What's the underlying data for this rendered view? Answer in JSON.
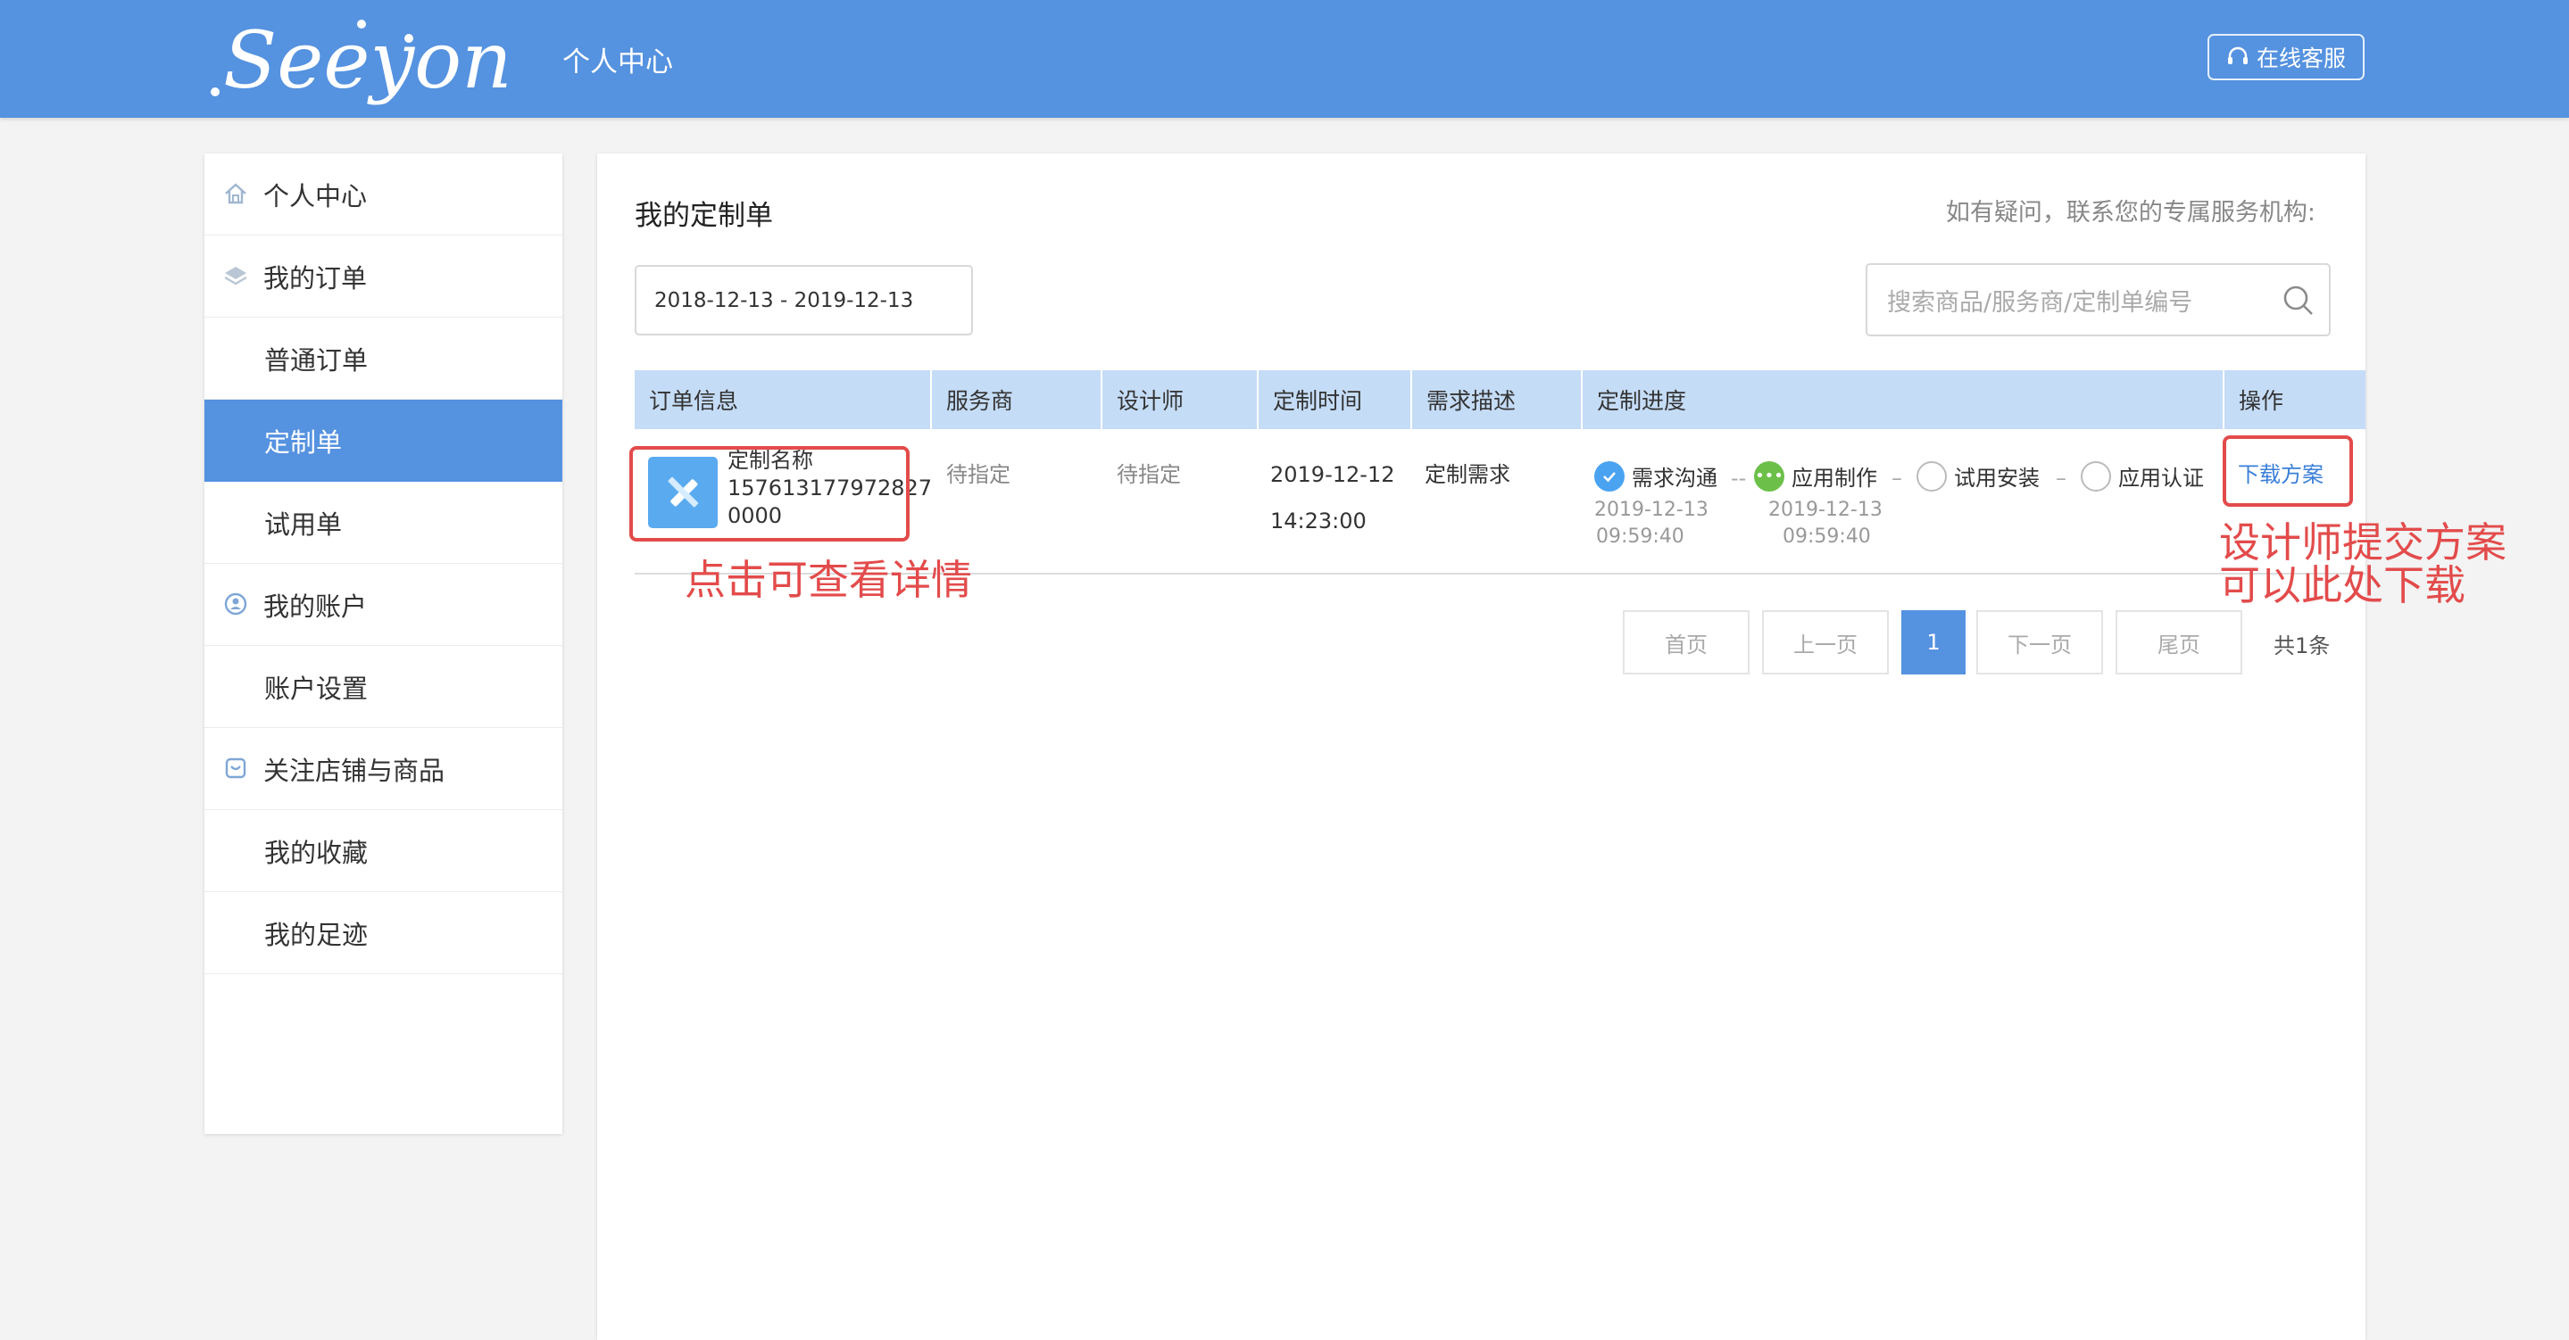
{
  "header": {
    "logo_text": "Seeyon",
    "title": "个人中心",
    "service_button": "在线客服"
  },
  "sidebar": {
    "items": [
      {
        "label": "个人中心",
        "type": "group",
        "icon": "home-icon"
      },
      {
        "label": "我的订单",
        "type": "group",
        "icon": "layers-icon"
      },
      {
        "label": "普通订单",
        "type": "sub"
      },
      {
        "label": "定制单",
        "type": "sub",
        "active": true
      },
      {
        "label": "试用单",
        "type": "sub"
      },
      {
        "label": "我的账户",
        "type": "group",
        "icon": "user-circle-icon"
      },
      {
        "label": "账户设置",
        "type": "sub"
      },
      {
        "label": "关注店铺与商品",
        "type": "group",
        "icon": "shop-icon"
      },
      {
        "label": "我的收藏",
        "type": "sub"
      },
      {
        "label": "我的足迹",
        "type": "sub"
      }
    ]
  },
  "main": {
    "title": "我的定制单",
    "contact_hint": "如有疑问，联系您的专属服务机构:",
    "date_range": "2018-12-13 - 2019-12-13",
    "search_placeholder": "搜索商品/服务商/定制单编号",
    "columns": [
      "订单信息",
      "服务商",
      "设计师",
      "定制时间",
      "需求描述",
      "定制进度",
      "操作"
    ],
    "row": {
      "name": "定制名称",
      "number_line1": "157613177972827",
      "number_line2": "0000",
      "provider": "待指定",
      "designer": "待指定",
      "date": "2019-12-12",
      "time": "14:23:00",
      "description": "定制需求",
      "steps": [
        {
          "label": "需求沟通",
          "date": "2019-12-13",
          "time": "09:59:40",
          "state": "done"
        },
        {
          "label": "应用制作",
          "date": "2019-12-13",
          "time": "09:59:40",
          "state": "current"
        },
        {
          "label": "试用安装",
          "state": "pending"
        },
        {
          "label": "应用认证",
          "state": "pending"
        }
      ],
      "action": "下载方案"
    },
    "pagination": {
      "first": "首页",
      "prev": "上一页",
      "current": "1",
      "next": "下一页",
      "last": "尾页",
      "total": "共1条"
    }
  },
  "annotations": {
    "detail_hint": "点击可查看详情",
    "download_hint_line1": "设计师提交方案",
    "download_hint_line2": "可以此处下载"
  },
  "colors": {
    "brand": "#5592e0",
    "table_header": "#c5dcf6",
    "annotation": "#e34b4b",
    "step_done": "#4aa3f0",
    "step_current": "#6cc04a"
  }
}
